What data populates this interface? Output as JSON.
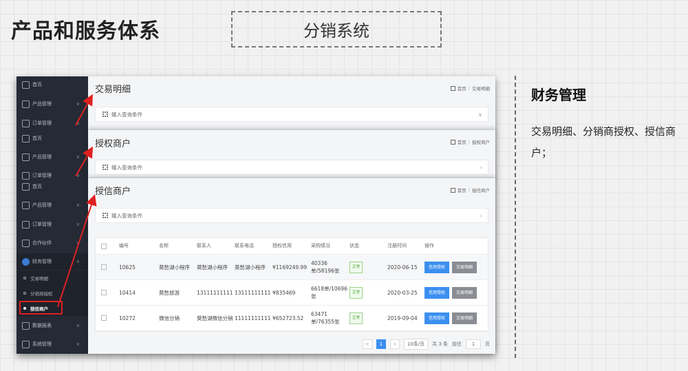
{
  "slide": {
    "title": "产品和服务体系",
    "system": "分销系统"
  },
  "right": {
    "title": "财务管理",
    "desc": "交易明细、分销商授权、授信商户；"
  },
  "sidebar": {
    "s1": [
      "首页",
      "产品管理",
      "订单管理"
    ],
    "s2": [
      "首页",
      "产品管理",
      "订单管理"
    ],
    "s3": [
      "首页",
      "产品管理",
      "订单管理",
      "合作伙伴",
      "财务管理"
    ],
    "subs": [
      "交易明细",
      "分销商授权",
      "授信商户"
    ],
    "bottom": [
      "数据报表",
      "系统管理"
    ]
  },
  "panels": {
    "p1": {
      "title": "交易明细",
      "home": "首页",
      "crumb": "交易明细",
      "query": "输入查询条件"
    },
    "p2": {
      "title": "授权商户",
      "home": "首页",
      "crumb": "授权商户",
      "query": "输入查询条件"
    },
    "p3": {
      "title": "授信商户",
      "home": "首页",
      "crumb": "授信商户",
      "query": "输入查询条件"
    }
  },
  "table": {
    "headers": [
      "编号",
      "名称",
      "联系人",
      "联系电话",
      "授权信用",
      "采购情况",
      "状态",
      "注册时间",
      "操作"
    ],
    "rows": [
      {
        "id": "10625",
        "name": "莫愁湖小程序",
        "contact": "莫愁湖小程序",
        "phone": "莫愁湖小程序",
        "credit": "¥1169249.99",
        "purchase": "40336单/58196张",
        "status": "正常",
        "date": "2020-06-15",
        "btn1": "信用授权",
        "btn2": "交易明细"
      },
      {
        "id": "10414",
        "name": "莫愁旅游",
        "contact": "13111111111",
        "phone": "13111111111",
        "credit": "¥835469",
        "purchase": "6618单/10696张",
        "status": "正常",
        "date": "2020-03-25",
        "btn1": "信用授权",
        "btn2": "交易明细"
      },
      {
        "id": "10272",
        "name": "微信分销",
        "contact": "莫愁湖微信分销",
        "phone": "11111111111",
        "credit": "¥652723.52",
        "purchase": "63471单/76355张",
        "status": "正常",
        "date": "2019-09-04",
        "btn1": "信用授权",
        "btn2": "交易明细"
      }
    ]
  },
  "pager": {
    "prev": "<",
    "page": "1",
    "next": ">",
    "size": "10条/页",
    "total": "共 3 条",
    "goto": "前往",
    "goto_val": "1",
    "page_unit": "页"
  },
  "colors": {
    "sidebar": "#252a35",
    "primary": "#3b8ff0",
    "highlight": "#e02020"
  }
}
